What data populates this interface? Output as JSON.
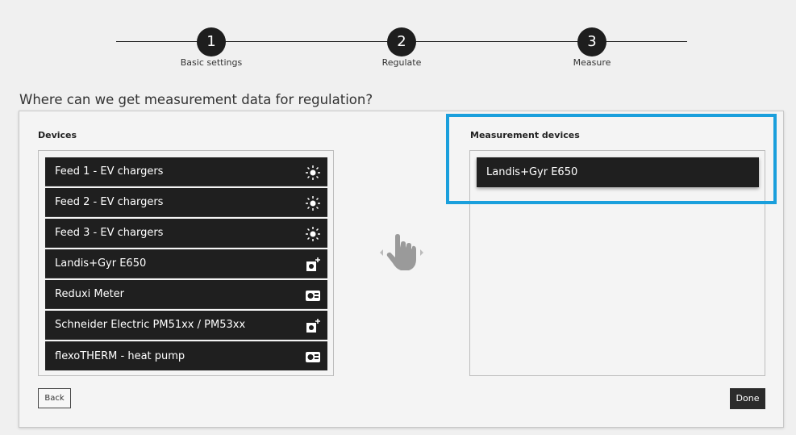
{
  "stepper": {
    "steps": [
      {
        "number": "1",
        "label": "Basic settings"
      },
      {
        "number": "2",
        "label": "Regulate"
      },
      {
        "number": "3",
        "label": "Measure"
      }
    ]
  },
  "question": "Where can we get measurement data for regulation?",
  "devices": {
    "title": "Devices",
    "items": [
      {
        "label": "Feed 1 - EV chargers",
        "icon": "sun-icon"
      },
      {
        "label": "Feed 2 - EV chargers",
        "icon": "sun-icon"
      },
      {
        "label": "Feed 3 - EV chargers",
        "icon": "sun-icon"
      },
      {
        "label": "Landis+Gyr E650",
        "icon": "meter-plus-icon"
      },
      {
        "label": "Reduxi Meter",
        "icon": "energy-meter-icon"
      },
      {
        "label": "Schneider Electric PM51xx / PM53xx",
        "icon": "meter-plus-icon"
      },
      {
        "label": "flexoTHERM - heat pump",
        "icon": "energy-meter-icon"
      }
    ]
  },
  "measurement": {
    "title": "Measurement devices",
    "items": [
      {
        "label": "Landis+Gyr E650"
      }
    ]
  },
  "buttons": {
    "back": "Back",
    "done": "Done"
  },
  "colors": {
    "highlight": "#1a9fdc",
    "item_bg": "#1f1f1f"
  }
}
